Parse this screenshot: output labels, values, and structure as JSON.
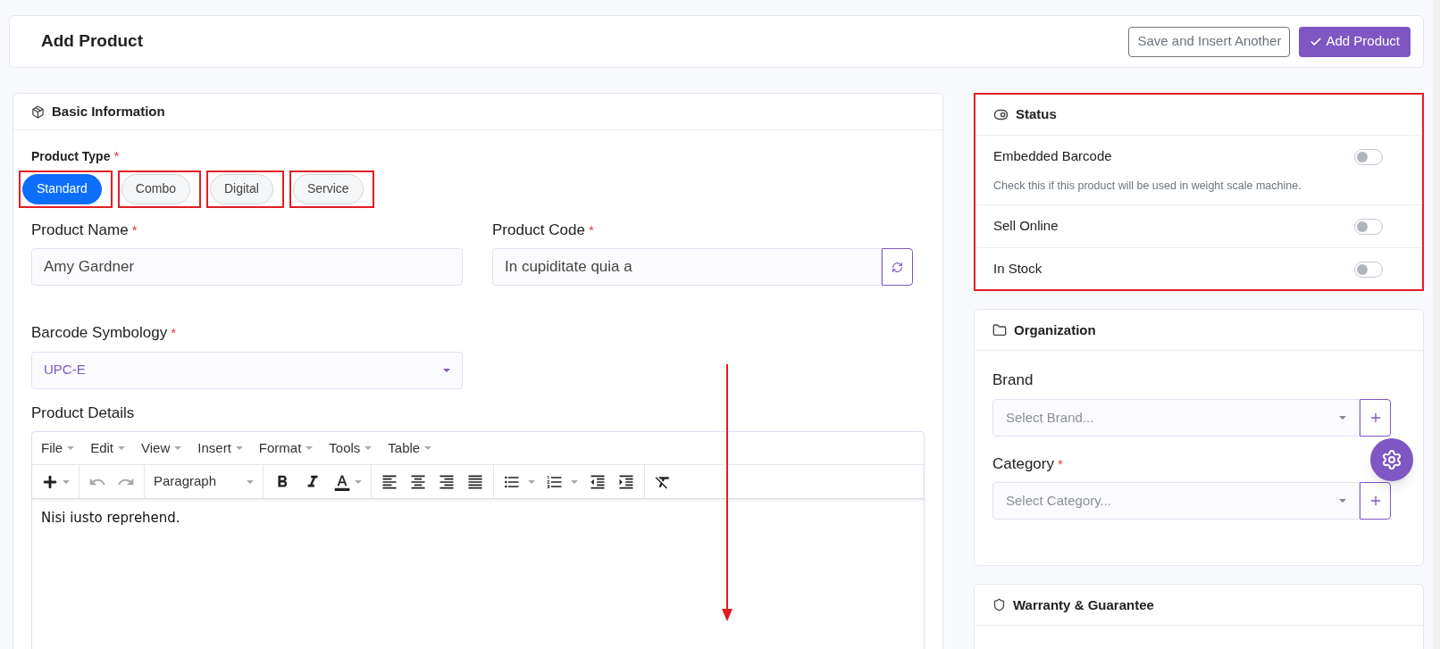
{
  "header": {
    "title": "Add Product",
    "buttons": [
      {
        "label": "Save and Insert Another",
        "kind": "outline"
      },
      {
        "label": "Add Product",
        "kind": "primary"
      }
    ]
  },
  "basic_information": {
    "title": "Basic Information",
    "product_type": {
      "label": "Product Type",
      "required_mark": "*",
      "options": [
        {
          "label": "Standard",
          "selected": true,
          "highlighted": true
        },
        {
          "label": "Combo",
          "selected": false,
          "highlighted": true
        },
        {
          "label": "Digital",
          "selected": false,
          "highlighted": true
        },
        {
          "label": "Service",
          "selected": false,
          "highlighted": true
        }
      ]
    },
    "product_name": {
      "label": "Product Name",
      "required_mark": "*",
      "value": "Amy Gardner"
    },
    "product_code": {
      "label": "Product Code",
      "required_mark": "*",
      "value": "In cupiditate quia a"
    },
    "barcode_symbology": {
      "label": "Barcode Symbology",
      "required_mark": "*",
      "value": "UPC-E"
    },
    "product_details": {
      "label": "Product Details",
      "menu": [
        "File",
        "Edit",
        "View",
        "Insert",
        "Format",
        "Tools",
        "Table"
      ],
      "block_format": "Paragraph",
      "content": "Nisi iusto reprehend."
    }
  },
  "status": {
    "title": "Status",
    "highlighted": true,
    "toggles": [
      {
        "label": "Embedded Barcode",
        "description": "Check this if this product will be used in weight scale machine.",
        "on": false
      },
      {
        "label": "Sell Online",
        "on": false
      },
      {
        "label": "In Stock",
        "on": false
      }
    ]
  },
  "organization": {
    "title": "Organization",
    "fields": [
      {
        "label": "Brand",
        "placeholder": "Select Brand..."
      },
      {
        "label": "Category",
        "required_mark": "*",
        "placeholder": "Select Category..."
      }
    ]
  },
  "warranty": {
    "title": "Warranty & Guarantee"
  }
}
